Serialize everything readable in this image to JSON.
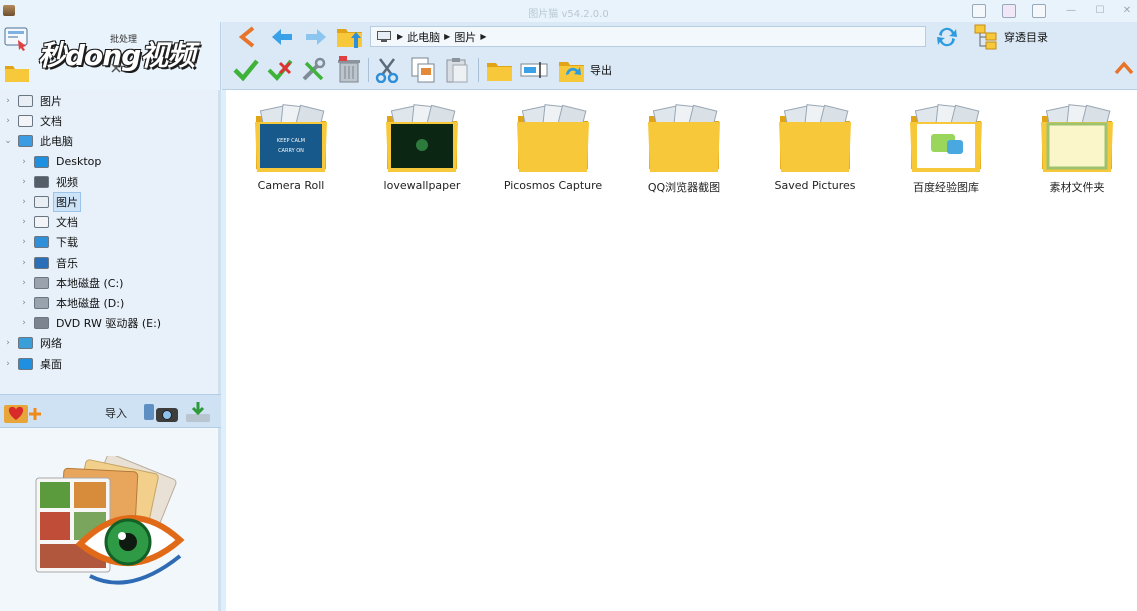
{
  "window": {
    "title": "图片猫 v54.2.0.0"
  },
  "brand": {
    "logo_text": "秒dong视频",
    "batch_label": "批处理"
  },
  "address_bar": {
    "segments": [
      "此电脑",
      "图片"
    ]
  },
  "toolbar": {
    "tree_toggle_label": "穿透目录",
    "export_label": "导出"
  },
  "tree": [
    {
      "label": "图片",
      "level": 0,
      "icon": "pictures-icon"
    },
    {
      "label": "文档",
      "level": 0,
      "icon": "documents-icon"
    },
    {
      "label": "此电脑",
      "level": 0,
      "icon": "this-pc-icon",
      "expanded": true
    },
    {
      "label": "Desktop",
      "level": 1,
      "icon": "desktop-icon"
    },
    {
      "label": "视频",
      "level": 1,
      "icon": "videos-icon"
    },
    {
      "label": "图片",
      "level": 1,
      "icon": "pictures-icon",
      "selected": true
    },
    {
      "label": "文档",
      "level": 1,
      "icon": "documents-icon"
    },
    {
      "label": "下载",
      "level": 1,
      "icon": "downloads-icon"
    },
    {
      "label": "音乐",
      "level": 1,
      "icon": "music-icon"
    },
    {
      "label": "本地磁盘 (C:)",
      "level": 1,
      "icon": "drive-icon"
    },
    {
      "label": "本地磁盘 (D:)",
      "level": 1,
      "icon": "drive-icon"
    },
    {
      "label": "DVD RW 驱动器 (E:)",
      "level": 1,
      "icon": "dvd-drive-icon"
    },
    {
      "label": "网络",
      "level": 0,
      "icon": "network-icon"
    },
    {
      "label": "桌面",
      "level": 0,
      "icon": "desktop-icon"
    }
  ],
  "import_panel": {
    "import_label": "导入"
  },
  "folders": [
    {
      "label": "Camera Roll",
      "thumb": "keep-calm"
    },
    {
      "label": "lovewallpaper",
      "thumb": "dark-green"
    },
    {
      "label": "Picosmos Capture",
      "thumb": "none"
    },
    {
      "label": "QQ浏览器截图",
      "thumb": "none"
    },
    {
      "label": "Saved Pictures",
      "thumb": "none"
    },
    {
      "label": "百度经验图库",
      "thumb": "jingyan"
    },
    {
      "label": "素材文件夹",
      "thumb": "frame"
    }
  ],
  "colors": {
    "folder": "#f6c83a",
    "folder_dark": "#e2a417",
    "accent": "#2f8fd9",
    "selection": "#cde3f8"
  }
}
